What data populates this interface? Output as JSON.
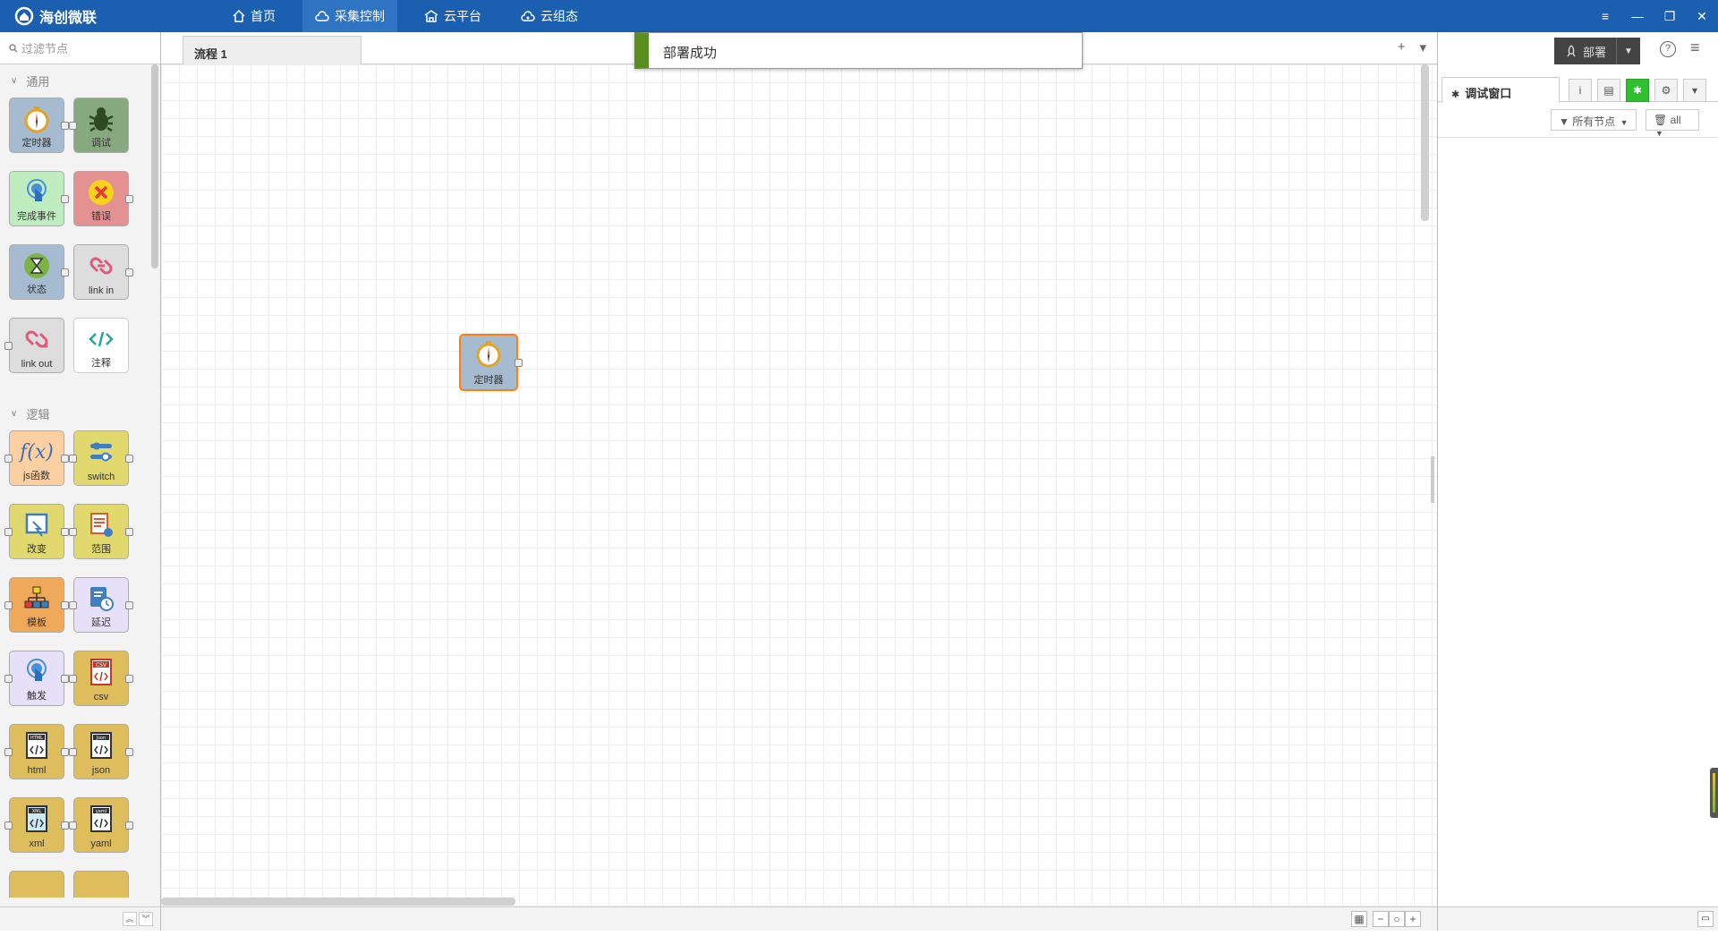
{
  "app": {
    "title": "海创微联"
  },
  "nav": {
    "tabs": [
      {
        "label": "首页"
      },
      {
        "label": "采集控制"
      },
      {
        "label": "云平台"
      },
      {
        "label": "云组态"
      }
    ]
  },
  "window": {
    "menu": "≡",
    "minimize": "—",
    "restore": "❐",
    "close": "✕"
  },
  "palette": {
    "filter_placeholder": "过滤节点",
    "categories": [
      {
        "name": "通用",
        "nodes": [
          "定时器",
          "调试",
          "完成事件",
          "错误",
          "状态",
          "link in",
          "link out",
          "注释"
        ]
      },
      {
        "name": "逻辑",
        "nodes": [
          "js函数",
          "switch",
          "改变",
          "范围",
          "模板",
          "延迟",
          "触发",
          "csv",
          "html",
          "json",
          "xml",
          "yaml"
        ]
      }
    ],
    "icon_tags": {
      "csv": "CSV",
      "html": "HTML",
      "json": "Json",
      "xml": "XML",
      "yaml": "yaml"
    }
  },
  "workspace": {
    "tab": "流程 1",
    "add": "+",
    "menu": "▾",
    "node_label": "定时器",
    "notification": "部署成功",
    "zoom": {
      "map": "▦",
      "out": "−",
      "reset": "○",
      "in": "+"
    }
  },
  "sidebar": {
    "deploy_label": "部署",
    "help": "?",
    "menu": "≡",
    "tab_label": "调试窗口",
    "tab_buttons": {
      "info": "i",
      "help": "▤",
      "debug": "✱",
      "config": "⚙",
      "more": "▾"
    },
    "filter_nodes": "所有节点",
    "clear_label": "all"
  },
  "colors": {
    "topbar": "#1b5fb0",
    "notify_accent": "#5a8e1e",
    "selected_border": "#ff7f0e",
    "debug_active": "#2fc02f"
  }
}
